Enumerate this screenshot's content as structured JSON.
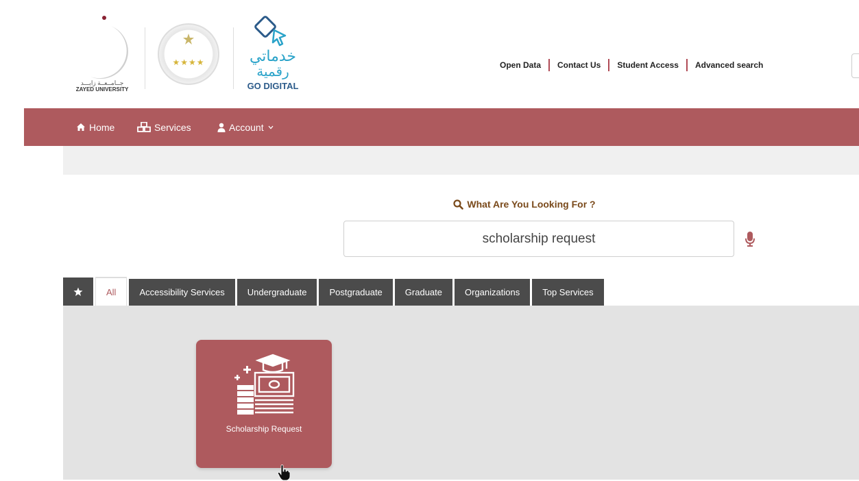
{
  "header": {
    "university": {
      "arabic": "جــامــعــة زايـــد",
      "english": "ZAYED UNIVERSITY"
    },
    "seal": {
      "stars": "★★★★"
    },
    "go_digital": {
      "arabic_line1": "خدماتي",
      "arabic_line2": "رقمية",
      "label": "GO DIGITAL"
    },
    "top_links": [
      "Open Data",
      "Contact Us",
      "Student Access",
      "Advanced search"
    ]
  },
  "nav": {
    "home": "Home",
    "services": "Services",
    "account": "Account"
  },
  "search": {
    "title": "What Are You Looking For ?",
    "value": "scholarship request"
  },
  "tabs": {
    "items": [
      "All",
      "Accessibility Services",
      "Undergraduate",
      "Postgraduate",
      "Graduate",
      "Organizations",
      "Top Services"
    ],
    "active": "All"
  },
  "cards": [
    {
      "label": "Scholarship Request",
      "icon": "scholarship-icon"
    }
  ],
  "colors": {
    "brand": "#ae5a5e",
    "tab_dark": "#4b4b4b",
    "search_title": "#7a4a1b",
    "go_digital_blue": "#2aa3c9"
  }
}
